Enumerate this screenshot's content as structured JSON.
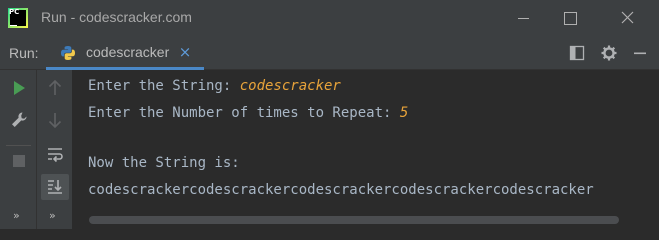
{
  "window": {
    "title": "Run - codescracker.com",
    "logo_text": "PC",
    "controls": [
      "minimize-icon",
      "maximize-icon",
      "close-icon"
    ]
  },
  "run_panel": {
    "label": "Run:",
    "tab": {
      "icon": "python-icon",
      "label": "codescracker",
      "close_glyph": "×"
    },
    "header_icons": [
      "layout-icon",
      "gear-icon",
      "minimize-panel-icon"
    ]
  },
  "toolbar_left": [
    "run-icon",
    "wrench-icon",
    "stop-icon",
    "more-icon"
  ],
  "toolbar_right": [
    "arrow-up-icon",
    "arrow-down-icon",
    "soft-wrap-icon",
    "scroll-to-end-icon",
    "more-icon"
  ],
  "more_glyph": "»",
  "console": {
    "lines": [
      {
        "prompt": "Enter the String: ",
        "input": "codescracker"
      },
      {
        "prompt": "Enter the Number of times to Repeat: ",
        "input": "5"
      },
      {
        "text": ""
      },
      {
        "text": "Now the String is:"
      },
      {
        "text": "codescrackercodescrackercodescrackercodescrackercodescracker"
      }
    ]
  },
  "colors": {
    "background": "#2b2b2b",
    "panel": "#3c3f41",
    "text": "#a9b7c6",
    "user_input": "#e8a33a",
    "accent": "#4a88c7",
    "run_green": "#499c54"
  }
}
